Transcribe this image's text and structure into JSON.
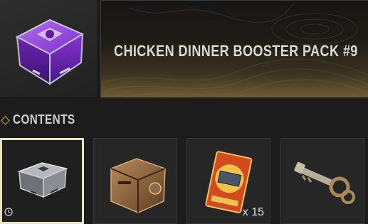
{
  "header": {
    "pack_title": "CHICKEN DINNER BOOSTER PACK #9",
    "pack_icon": "purple-crate-icon"
  },
  "contents": {
    "label": "CONTENTS",
    "items": [
      {
        "icon": "steel-case-icon",
        "quantity": "",
        "selected": true,
        "timed": true
      },
      {
        "icon": "bronze-crate-icon",
        "quantity": "",
        "selected": false,
        "timed": false
      },
      {
        "icon": "coupon-ticket-icon",
        "quantity": "x 15",
        "selected": false,
        "timed": false
      },
      {
        "icon": "key-icon",
        "quantity": "",
        "selected": false,
        "timed": false
      }
    ]
  },
  "colors": {
    "accent_gold": "#c9a85c",
    "selected_border": "#eae3bf",
    "crate_purple": "#7a2fc8"
  }
}
